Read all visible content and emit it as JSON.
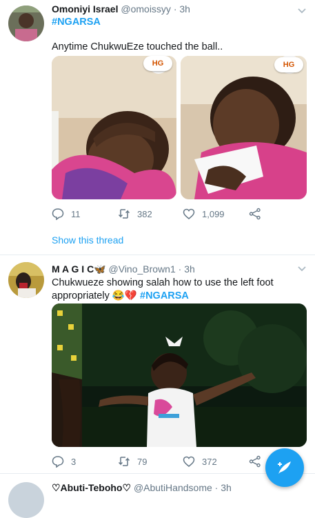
{
  "tweets": [
    {
      "name": "Omoniyi Israel",
      "handle": "@omoissyy",
      "time": "· 3h",
      "hashtag_line": "#NGARSA",
      "text": "Anytime ChukwuEze touched the ball..",
      "media_badge": "HG",
      "replies": "11",
      "retweets": "382",
      "likes": "1,099",
      "thread_link": "Show this thread"
    },
    {
      "name": "M A G I C",
      "name_emoji": "🦋",
      "handle": "@Vino_Brown1",
      "time": "· 3h",
      "text_line1": "Chukwueze showing salah how to use the left foot",
      "text_line2": "appropriately",
      "text_emojis": "😂💔",
      "hashtag": "#NGARSA",
      "replies": "3",
      "retweets": "79",
      "likes": "372"
    },
    {
      "name": "♡Abuti-Teboho♡",
      "handle": "@AbutiHandsome",
      "time": "· 3h"
    }
  ],
  "colors": {
    "accent": "#1da1f2",
    "muted": "#657786",
    "text": "#14171a"
  },
  "icons": [
    "reply-icon",
    "retweet-icon",
    "like-icon",
    "share-icon",
    "chevron-down-icon",
    "compose-icon"
  ]
}
